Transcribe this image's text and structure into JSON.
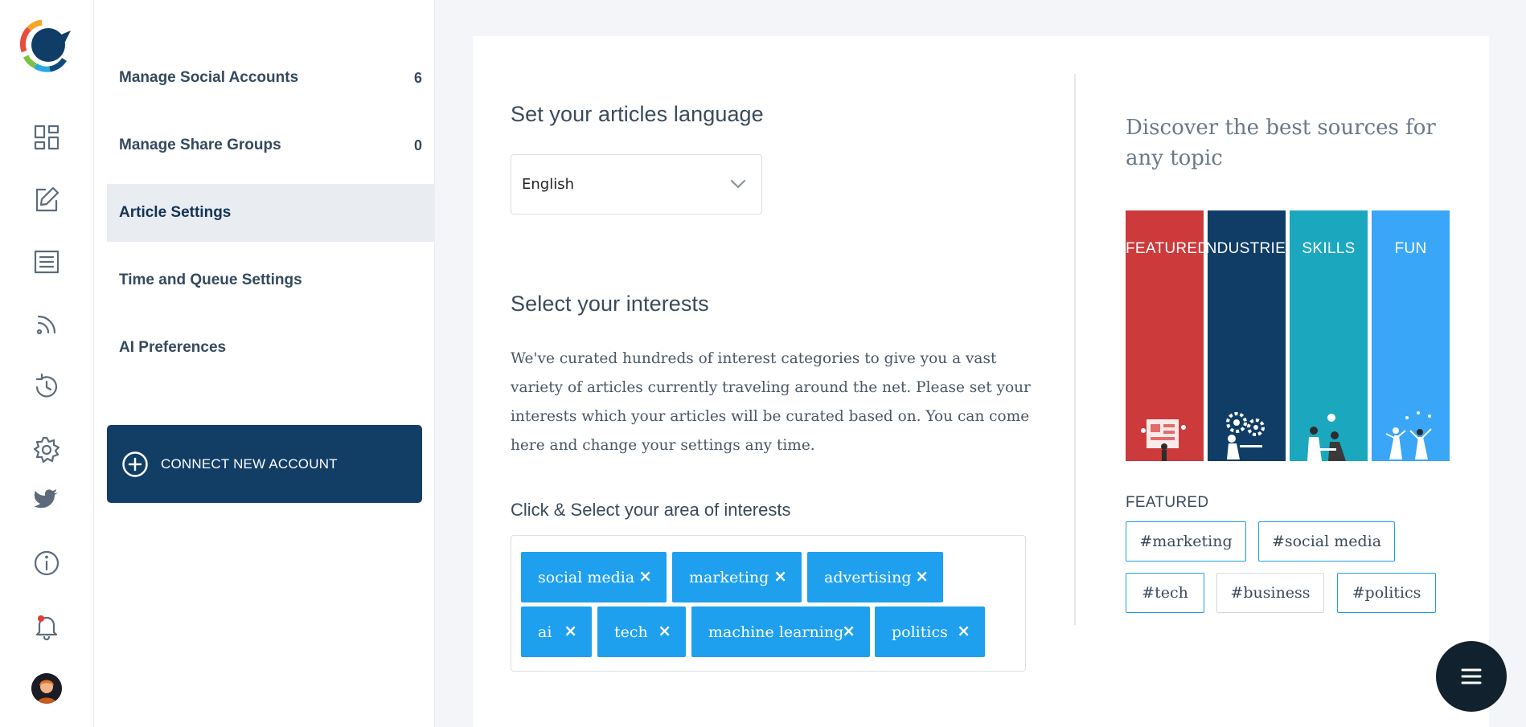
{
  "app": {
    "brand_colors": {
      "primary_dark": "#123e66",
      "chip_blue": "#1ea0ef",
      "featured_red": "#cc3a3b",
      "industries_navy": "#0f3d66",
      "skills_teal": "#1ba8bf",
      "fun_blue": "#3aa6f7"
    }
  },
  "rail": {
    "icons": [
      "dashboard-icon",
      "compose-icon",
      "articles-icon",
      "rss-feed-icon",
      "history-sync-icon",
      "settings-gear-icon",
      "twitter-icon",
      "info-icon",
      "notification-bell-icon"
    ]
  },
  "settings_nav": {
    "items": [
      {
        "label": "Manage Social Accounts",
        "count": "6"
      },
      {
        "label": "Manage Share Groups",
        "count": "0"
      },
      {
        "label": "Article Settings",
        "count": ""
      },
      {
        "label": "Time and Queue Settings",
        "count": ""
      },
      {
        "label": "AI Preferences",
        "count": ""
      }
    ],
    "active_item": "Article Settings",
    "connect_button": "CONNECT NEW ACCOUNT"
  },
  "main": {
    "language_heading": "Set your articles language",
    "language_value": "English",
    "interests_heading": "Select your interests",
    "interests_description": "We've curated hundreds of interest categories to give you a vast variety of articles currently traveling around the net. Please set your interests which your articles will be curated based on. You can come here and change your settings any time.",
    "area_heading": "Click & Select your area of interests",
    "remove_symbol": "×",
    "selected_interests": [
      "social media",
      "marketing",
      "advertising",
      "ai",
      "tech",
      "machine learning",
      "politics"
    ]
  },
  "discover": {
    "heading": "Discover the best sources for any topic",
    "categories": [
      {
        "label": "FEATURED",
        "color": "#cc3a3b"
      },
      {
        "label": "INDUSTRIES",
        "color": "#0f3d66"
      },
      {
        "label": "SKILLS",
        "color": "#1ba8bf"
      },
      {
        "label": "FUN",
        "color": "#3aa6f7"
      }
    ],
    "selected_category_label": "FEATURED",
    "hashtags": [
      {
        "tag": "#marketing",
        "selected": true
      },
      {
        "tag": "#social media",
        "selected": true
      },
      {
        "tag": "#tech",
        "selected": true
      },
      {
        "tag": "#business",
        "selected": false
      },
      {
        "tag": "#politics",
        "selected": true
      }
    ]
  }
}
